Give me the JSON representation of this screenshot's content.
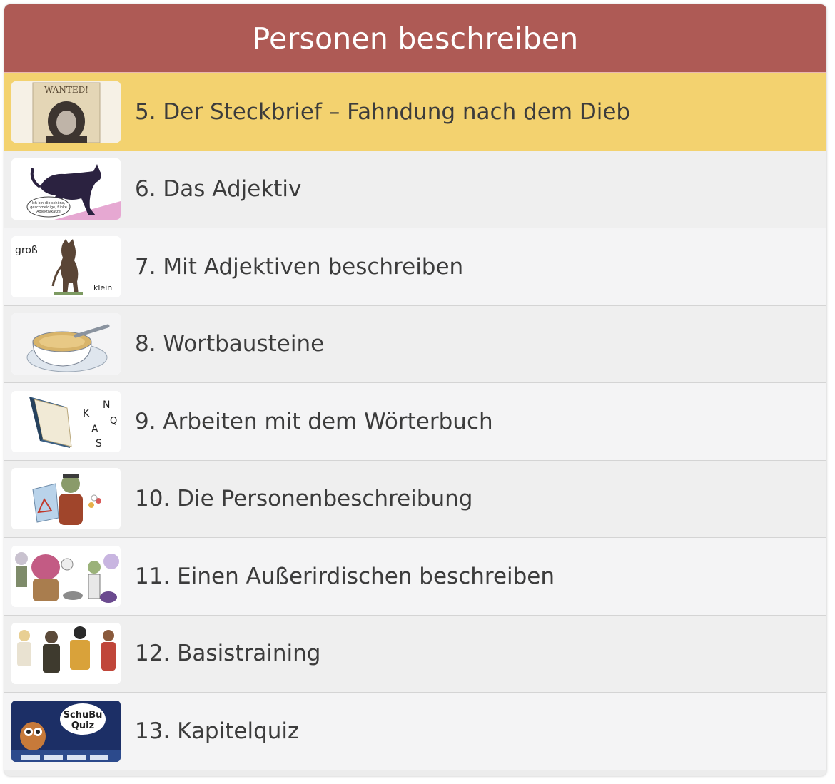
{
  "header": {
    "title": "Personen beschreiben"
  },
  "colors": {
    "header": "#ae5a55",
    "active": "#f3d26f"
  },
  "items": [
    {
      "label": "5. Der Steckbrief – Fahndung nach dem Dieb",
      "thumb_icon": "wanted-poster-icon",
      "thumb_text": "WANTED!"
    },
    {
      "label": "6. Das Adjektiv",
      "thumb_icon": "black-cat-icon",
      "thumb_text": "Ich bin die schöne, geschmeidige, flinke Adjektivkatze"
    },
    {
      "label": "7. Mit Adjektiven beschreiben",
      "thumb_icon": "cat-size-icon",
      "thumb_text_1": "groß",
      "thumb_text_2": "klein"
    },
    {
      "label": "8. Wortbausteine",
      "thumb_icon": "letter-soup-icon"
    },
    {
      "label": "9. Arbeiten mit dem Wörterbuch",
      "thumb_icon": "dictionary-icon"
    },
    {
      "label": "10. Die Personenbeschreibung",
      "thumb_icon": "detective-icon"
    },
    {
      "label": "11. Einen Außerirdischen beschreiben",
      "thumb_icon": "aliens-icon"
    },
    {
      "label": "12. Basistraining",
      "thumb_icon": "people-group-icon"
    },
    {
      "label": "13. Kapitelquiz",
      "thumb_icon": "quiz-owl-icon",
      "thumb_text_1": "SchuBu",
      "thumb_text_2": "Quiz"
    }
  ]
}
